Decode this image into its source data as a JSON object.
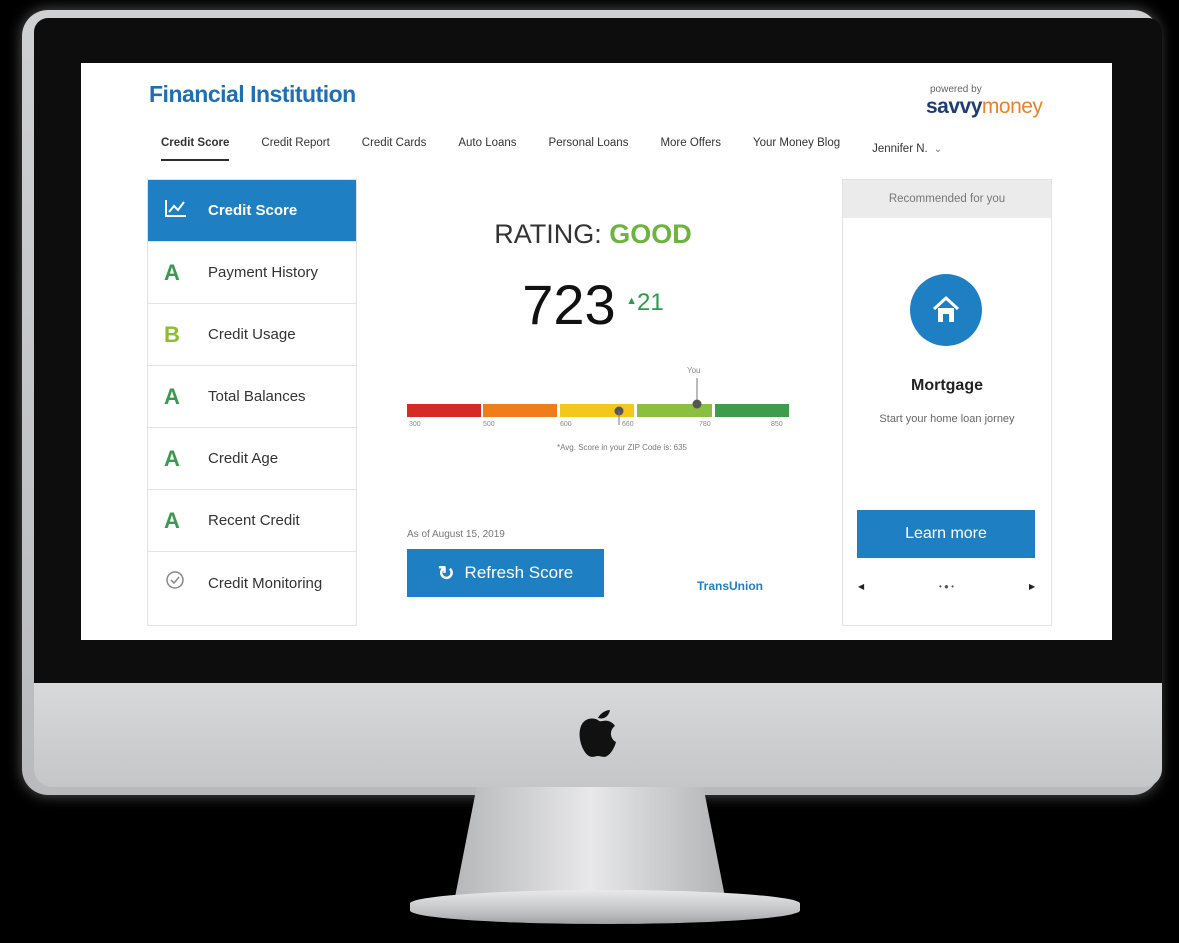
{
  "brand": {
    "title": "Financial Institution",
    "powered_by": "powered by",
    "logo_part1": "savvy",
    "logo_part2": "money"
  },
  "nav": {
    "items": [
      {
        "label": "Credit Score",
        "active": true
      },
      {
        "label": "Credit Report"
      },
      {
        "label": "Credit Cards"
      },
      {
        "label": "Auto Loans"
      },
      {
        "label": "Personal Loans"
      },
      {
        "label": "More Offers"
      },
      {
        "label": "Your Money Blog"
      }
    ],
    "user": "Jennifer N."
  },
  "sidebar": {
    "items": [
      {
        "grade": "",
        "label": "Credit Score",
        "icon": "chart-line-icon"
      },
      {
        "grade": "A",
        "label": "Payment History"
      },
      {
        "grade": "B",
        "label": "Credit Usage"
      },
      {
        "grade": "A",
        "label": "Total Balances"
      },
      {
        "grade": "A",
        "label": "Credit Age"
      },
      {
        "grade": "A",
        "label": "Recent Credit"
      },
      {
        "grade": "",
        "label": "Credit Monitoring",
        "icon": "monitoring-icon"
      }
    ]
  },
  "score": {
    "rating_label": "RATING:",
    "rating_value": "GOOD",
    "value": "723",
    "delta": "21",
    "scale_ticks": [
      "300",
      "500",
      "600",
      "660",
      "780",
      "850"
    ],
    "you_label": "You",
    "avg_text": "*Avg. Score in your ZIP Code is: 635",
    "as_of": "As of August 15, 2019",
    "refresh_label": "Refresh Score",
    "bureau": "TransUnion"
  },
  "recommend": {
    "header": "Recommended for you",
    "title": "Mortgage",
    "desc": "Start your home loan jorney",
    "cta": "Learn more",
    "icon": "house-icon"
  },
  "colors": {
    "accent": "#1f7fc3",
    "good": "#6db33f",
    "brand": "#1f6fb4",
    "segments": [
      "#d52b26",
      "#ef7e1a",
      "#f4c71c",
      "#8bbf3f",
      "#3d9d4c"
    ]
  }
}
